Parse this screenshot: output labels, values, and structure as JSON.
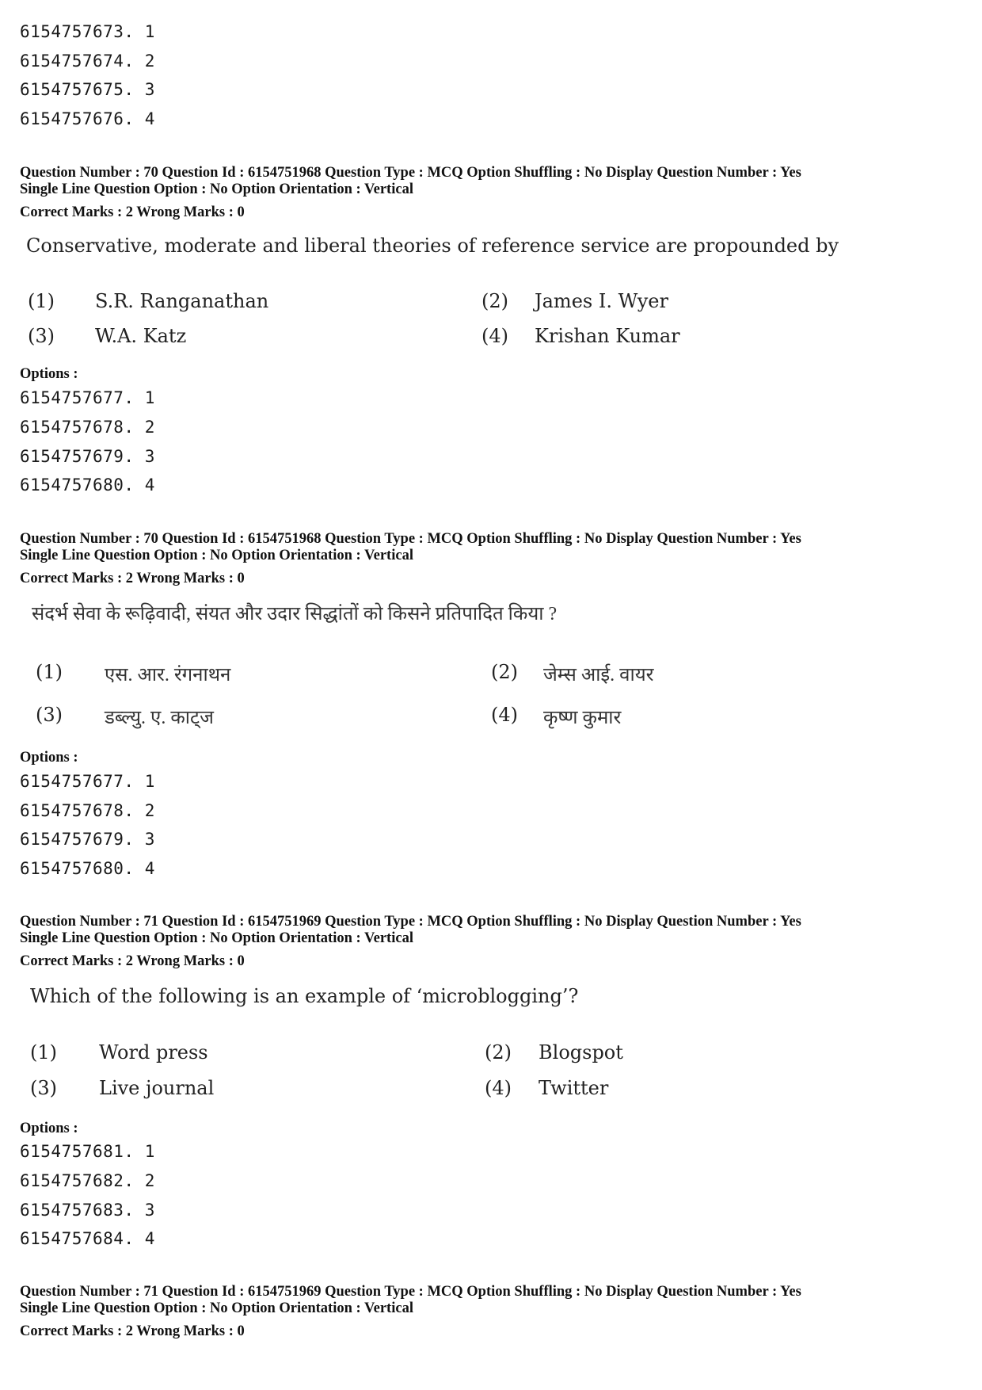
{
  "blocks": [
    {
      "options_label": "",
      "option_ids": [
        "6154757673. 1",
        "6154757674. 2",
        "6154757675. 3",
        "6154757676. 4"
      ]
    },
    {
      "header_line1": "Question Number : 70  Question Id : 6154751968  Question Type : MCQ  Option Shuffling : No  Display Question Number : Yes",
      "header_line2": "Single Line Question Option : No  Option Orientation : Vertical",
      "marks": "Correct Marks : 2  Wrong Marks : 0",
      "question": "Conservative, moderate and liberal theories of reference service are propounded by",
      "choices": [
        {
          "num": "(1)",
          "text": "S.R. Ranganathan"
        },
        {
          "num": "(2)",
          "text": "James I. Wyer"
        },
        {
          "num": "(3)",
          "text": "W.A. Katz"
        },
        {
          "num": "(4)",
          "text": "Krishan Kumar"
        }
      ],
      "options_label": "Options :",
      "option_ids": [
        "6154757677. 1",
        "6154757678. 2",
        "6154757679. 3",
        "6154757680. 4"
      ]
    },
    {
      "header_line1": "Question Number : 70  Question Id : 6154751968  Question Type : MCQ  Option Shuffling : No  Display Question Number : Yes",
      "header_line2": "Single Line Question Option : No  Option Orientation : Vertical",
      "marks": "Correct Marks : 2  Wrong Marks : 0",
      "question": "संदर्भ सेवा के रूढ़िवादी, संयत और उदार सिद्धांतों को किसने प्रतिपादित किया ?",
      "choices": [
        {
          "num": "(1)",
          "text": "एस. आर. रंगनाथन"
        },
        {
          "num": "(2)",
          "text": "जेम्स आई. वायर"
        },
        {
          "num": "(3)",
          "text": "डब्ल्यु. ए. काट्ज"
        },
        {
          "num": "(4)",
          "text": "कृष्ण कुमार"
        }
      ],
      "options_label": "Options :",
      "option_ids": [
        "6154757677. 1",
        "6154757678. 2",
        "6154757679. 3",
        "6154757680. 4"
      ]
    },
    {
      "header_line1": "Question Number : 71  Question Id : 6154751969  Question Type : MCQ  Option Shuffling : No  Display Question Number : Yes",
      "header_line2": "Single Line Question Option : No  Option Orientation : Vertical",
      "marks": "Correct Marks : 2  Wrong Marks : 0",
      "question": "Which of the following is an example of ‘microblogging’?",
      "choices": [
        {
          "num": "(1)",
          "text": "Word press"
        },
        {
          "num": "(2)",
          "text": "Blogspot"
        },
        {
          "num": "(3)",
          "text": "Live journal"
        },
        {
          "num": "(4)",
          "text": "Twitter"
        }
      ],
      "options_label": "Options :",
      "option_ids": [
        "6154757681. 1",
        "6154757682. 2",
        "6154757683. 3",
        "6154757684. 4"
      ]
    },
    {
      "header_line1": "Question Number : 71  Question Id : 6154751969  Question Type : MCQ  Option Shuffling : No  Display Question Number : Yes",
      "header_line2": "Single Line Question Option : No  Option Orientation : Vertical",
      "marks": "Correct Marks : 2  Wrong Marks : 0"
    }
  ]
}
